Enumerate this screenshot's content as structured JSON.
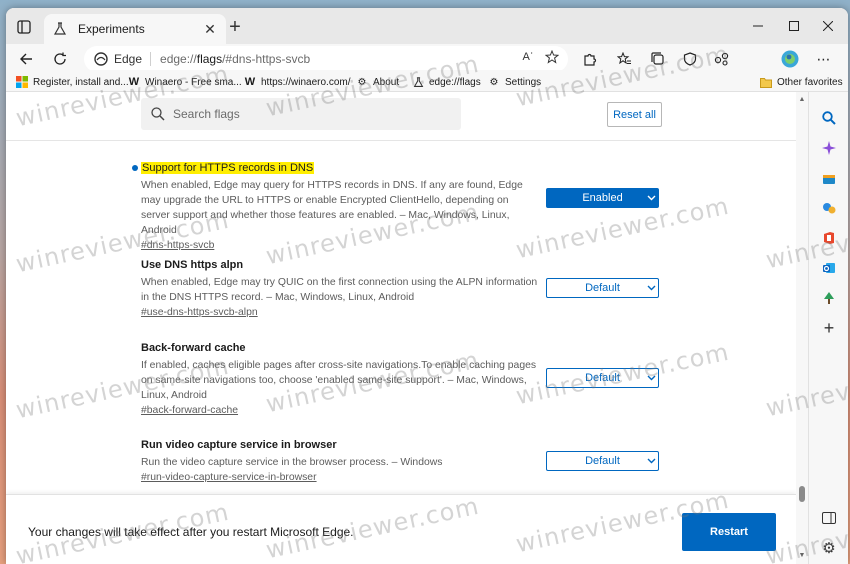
{
  "window": {
    "tab_title": "Experiments"
  },
  "toolbar": {
    "site_label": "Edge",
    "url_prefix": "edge://",
    "url_strong": "flags",
    "url_rest": "/#dns-https-svcb",
    "read_aloud": "Aʾ"
  },
  "favorites": [
    {
      "label": "Register, install and...",
      "icon": "windows-logo-icon"
    },
    {
      "label": "Winaero - Free sma...",
      "icon": "winaero-icon"
    },
    {
      "label": "https://winaero.com/",
      "icon": "winaero-icon"
    },
    {
      "label": "About",
      "icon": "gear-icon"
    },
    {
      "label": "edge://flags",
      "icon": "flask-icon"
    },
    {
      "label": "Settings",
      "icon": "gear-icon"
    }
  ],
  "other_favorites": "Other favorites",
  "search": {
    "placeholder": "Search flags"
  },
  "reset_label": "Reset all",
  "flags": [
    {
      "title": "Support for HTTPS records in DNS",
      "desc": "When enabled, Edge may query for HTTPS records in DNS. If any are found, Edge may upgrade the URL to HTTPS or enable Encrypted ClientHello, depending on server support and whether those features are enabled. – Mac, Windows, Linux, Android",
      "link": "#dns-https-svcb",
      "value": "Enabled"
    },
    {
      "title": "Use DNS https alpn",
      "desc": "When enabled, Edge may try QUIC on the first connection using the ALPN information in the DNS HTTPS record. – Mac, Windows, Linux, Android",
      "link": "#use-dns-https-svcb-alpn",
      "value": "Default"
    },
    {
      "title": "Back-forward cache",
      "desc": "If enabled, caches eligible pages after cross-site navigations.To enable caching pages on same-site navigations too, choose 'enabled same-site support'. – Mac, Windows, Linux, Android",
      "link": "#back-forward-cache",
      "value": "Default"
    },
    {
      "title": "Run video capture service in browser",
      "desc": "Run the video capture service in the browser process. – Windows",
      "link": "#run-video-capture-service-in-browser",
      "value": "Default"
    }
  ],
  "bottom": {
    "message": "Your changes will take effect after you restart Microsoft Edge.",
    "restart_label": "Restart"
  },
  "watermark": "winreviewer.com",
  "colors": {
    "accent": "#0067c0",
    "highlight": "#ffee00"
  }
}
